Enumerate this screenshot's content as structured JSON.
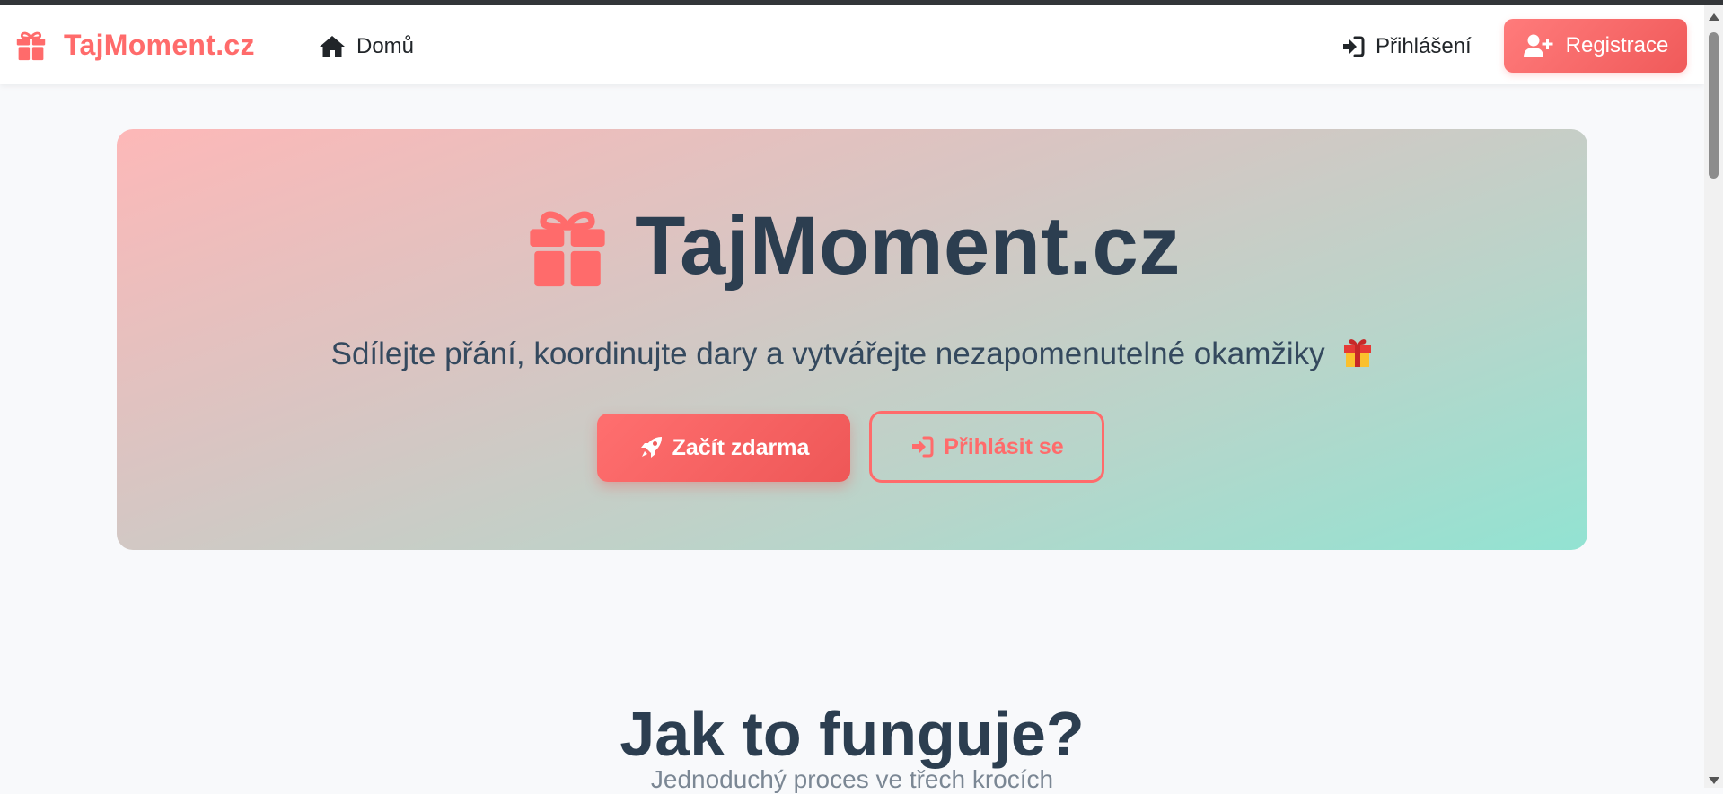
{
  "navbar": {
    "brand": "TajMoment.cz",
    "brand_icon": "gift-icon",
    "home_label": "Domů",
    "home_icon": "home-icon",
    "login_label": "Přihlášení",
    "login_icon": "sign-in-icon",
    "register_label": "Registrace",
    "register_icon": "user-plus-icon"
  },
  "hero": {
    "title": "TajMoment.cz",
    "title_icon": "gift-icon",
    "subtitle": "Sdílejte přání, koordinujte dary a vytvářejte nezapomenutelné okamžiky",
    "subtitle_emoji": "🎁",
    "start_button": "Začít zdarma",
    "start_icon": "rocket-icon",
    "login_button": "Přihlásit se",
    "login_icon": "sign-in-icon"
  },
  "how_it_works": {
    "title": "Jak to funguje?",
    "subtitle": "Jednoduchý proces ve třech krocích"
  },
  "colors": {
    "brand": "#ff6b6b",
    "text_dark": "#2c3e50",
    "hero_gradient_start": "#fdb8b8",
    "hero_gradient_end": "#92e3d2"
  }
}
